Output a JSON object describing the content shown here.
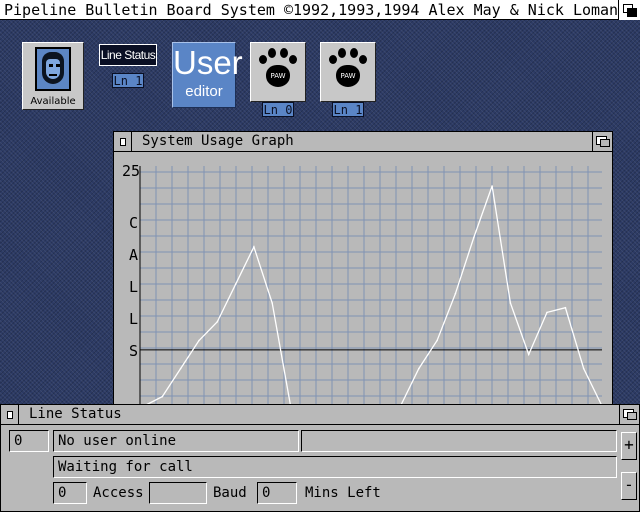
{
  "screen": {
    "title": "Pipeline Bulletin Board System ©1992,1993,1994 Alex May & Nick Loman"
  },
  "icons": {
    "available": {
      "caption": "Available"
    },
    "line_status": {
      "label": "Line Status",
      "line": "Ln 1"
    },
    "user_editor": {
      "big": "User",
      "small": "editor"
    },
    "paw_0": {
      "text": "PAW",
      "line": "Ln 0"
    },
    "paw_1": {
      "text": "PAW",
      "line": "Ln 1"
    }
  },
  "graph_window": {
    "title": "System Usage Graph",
    "y_max_label": "25",
    "side_letters": [
      "C",
      "A",
      "L",
      "L",
      "S"
    ]
  },
  "chart_data": {
    "type": "line",
    "ylim": [
      0,
      25
    ],
    "grid": true,
    "series": [
      {
        "values": [
          0,
          1,
          4,
          7,
          9,
          13,
          17,
          11,
          0,
          0,
          0,
          0,
          0,
          0,
          0,
          4,
          7,
          12,
          18,
          23.5,
          11,
          5.5,
          10,
          10.5,
          4,
          0
        ]
      }
    ],
    "threshold": 6
  },
  "status_window": {
    "title": "Line Status",
    "line_number": "0",
    "user_text": "No user online",
    "user_extra": "",
    "status_text": "Waiting for call",
    "access_value": "0",
    "access_label": "Access",
    "baud_value": "",
    "baud_label": "Baud",
    "mins_value": "0",
    "mins_label": "Mins Left",
    "scroll_up": "+",
    "scroll_down": "-"
  },
  "colors": {
    "desktop": "#2c3a64",
    "window": "#b9b9b9",
    "accent": "#5a85c6",
    "graph_grid": "#7f93b4"
  }
}
